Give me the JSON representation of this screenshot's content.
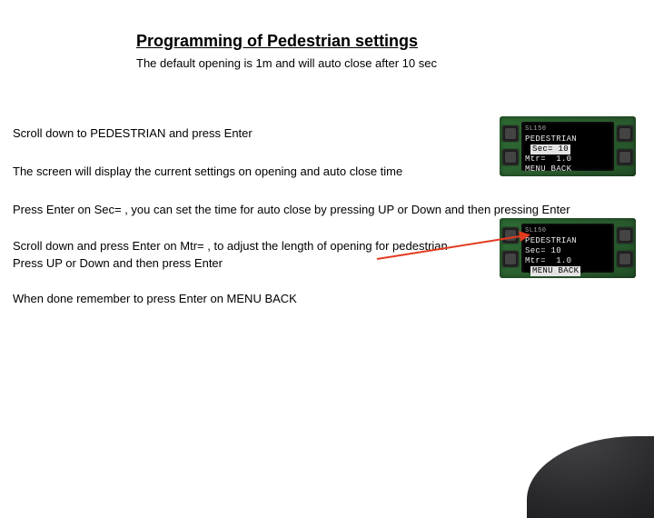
{
  "title": "Programming of Pedestrian settings",
  "subtitle": "The default opening is 1m and will auto close after 10 sec",
  "paragraphs": {
    "p1": "Scroll down to PEDESTRIAN and press Enter",
    "p2": "The screen will display the current settings on opening and auto close time",
    "p3": "Press Enter on Sec= , you can set the time for auto close by pressing UP or Down and then pressing Enter",
    "p4a": "Scroll down and press Enter on Mtr= , to adjust the length of opening for pedestrian",
    "p4b": "Press UP or Down and then press Enter",
    "p5": "When done remember to press Enter on MENU BACK"
  },
  "device1": {
    "model": "SL150",
    "line1": "PEDESTRIAN",
    "line2": "Sec= 10",
    "line3": "Mtr=  1.0",
    "line4": "MENU BACK",
    "highlight_line": 2
  },
  "device2": {
    "model": "SL150",
    "line1": "PEDESTRIAN",
    "line2": "Sec= 10",
    "line3": "Mtr=  1.0",
    "line4": "MENU BACK",
    "highlight_line": 4
  }
}
